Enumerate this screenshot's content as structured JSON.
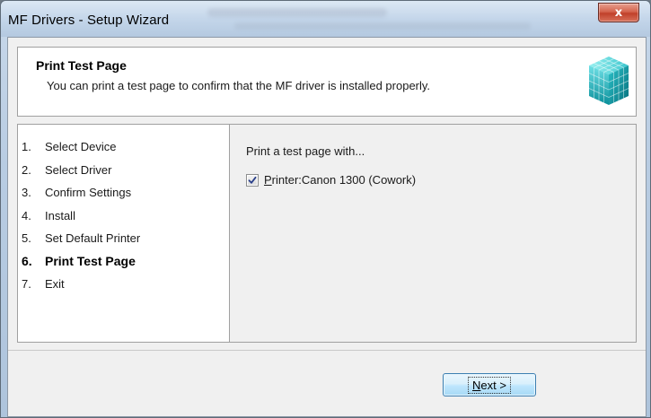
{
  "window": {
    "title": "MF Drivers - Setup Wizard",
    "close_glyph": "x"
  },
  "header": {
    "title": "Print Test Page",
    "description": "You can print a test page to confirm that the MF driver is installed properly.",
    "logo_icon": "setup-cube-icon"
  },
  "steps": {
    "items": [
      {
        "num": "1.",
        "label": "Select Device"
      },
      {
        "num": "2.",
        "label": "Select Driver"
      },
      {
        "num": "3.",
        "label": "Confirm Settings"
      },
      {
        "num": "4.",
        "label": "Install"
      },
      {
        "num": "5.",
        "label": "Set Default Printer"
      },
      {
        "num": "6.",
        "label": "Print Test Page",
        "active": true
      },
      {
        "num": "7.",
        "label": "Exit"
      }
    ]
  },
  "main": {
    "prompt": "Print a test page with...",
    "printer": {
      "checked": true,
      "accel": "P",
      "label_rest": "rinter:Canon 1300 (Cowork)"
    }
  },
  "footer": {
    "next_accel": "N",
    "next_rest": "ext >"
  },
  "colors": {
    "accent": "#3c7fb1",
    "close": "#c0402a",
    "logo": "#1ab0b0"
  }
}
